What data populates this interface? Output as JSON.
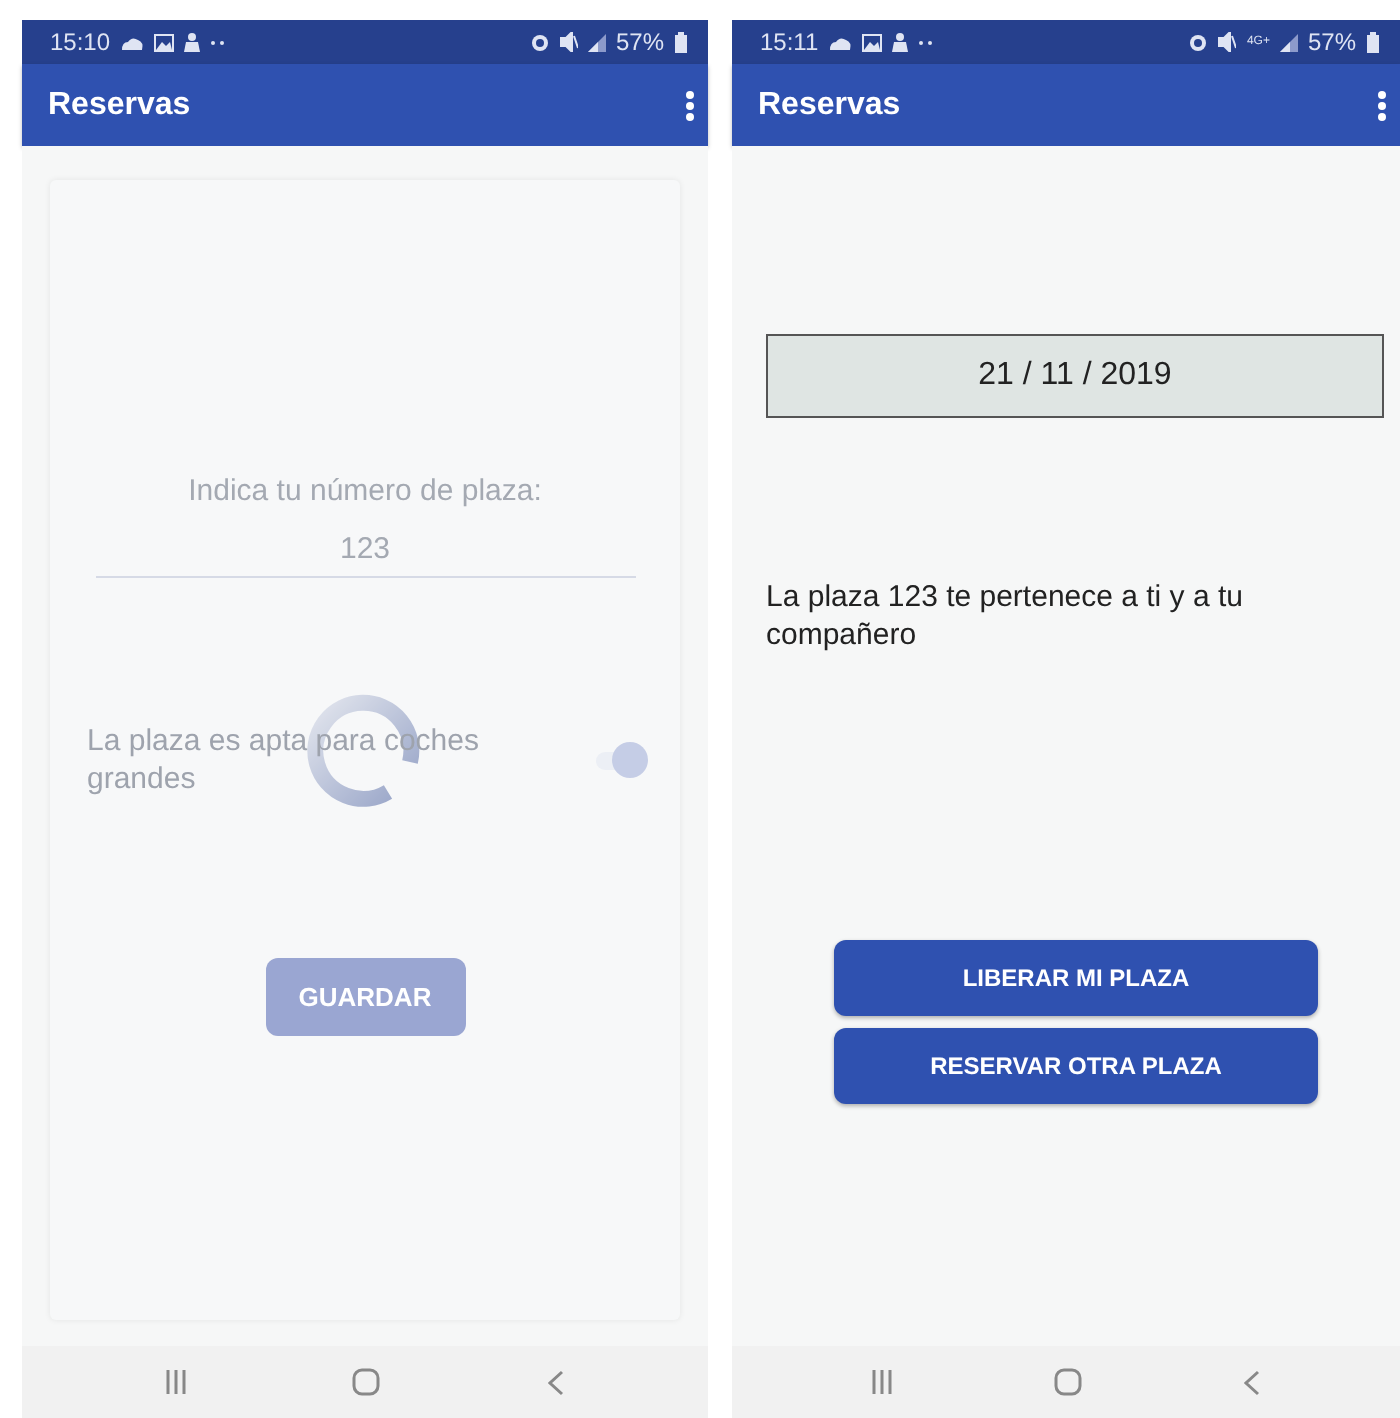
{
  "screens": [
    {
      "kind": "form",
      "status_bar": {
        "time": "15:10",
        "battery": "57%"
      },
      "app_bar": {
        "title": "Reservas"
      },
      "loading": true,
      "form": {
        "label": "Indica tu número de plaza:",
        "field_value": "123",
        "switch_label": "La plaza es apta para coches grandes",
        "switch_on": true,
        "button": "GUARDAR",
        "disabled": true
      }
    },
    {
      "kind": "details",
      "status_bar": {
        "time": "15:11",
        "network": "4G+",
        "battery": "57%"
      },
      "app_bar": {
        "title": "Reservas"
      },
      "details": {
        "date": "21 / 11 / 2019",
        "message": "La plaza 123 te pertenece a ti y a tu compañero",
        "buttons": [
          "LIBERAR MI PLAZA",
          "RESERVAR OTRA PLAZA"
        ]
      }
    }
  ]
}
